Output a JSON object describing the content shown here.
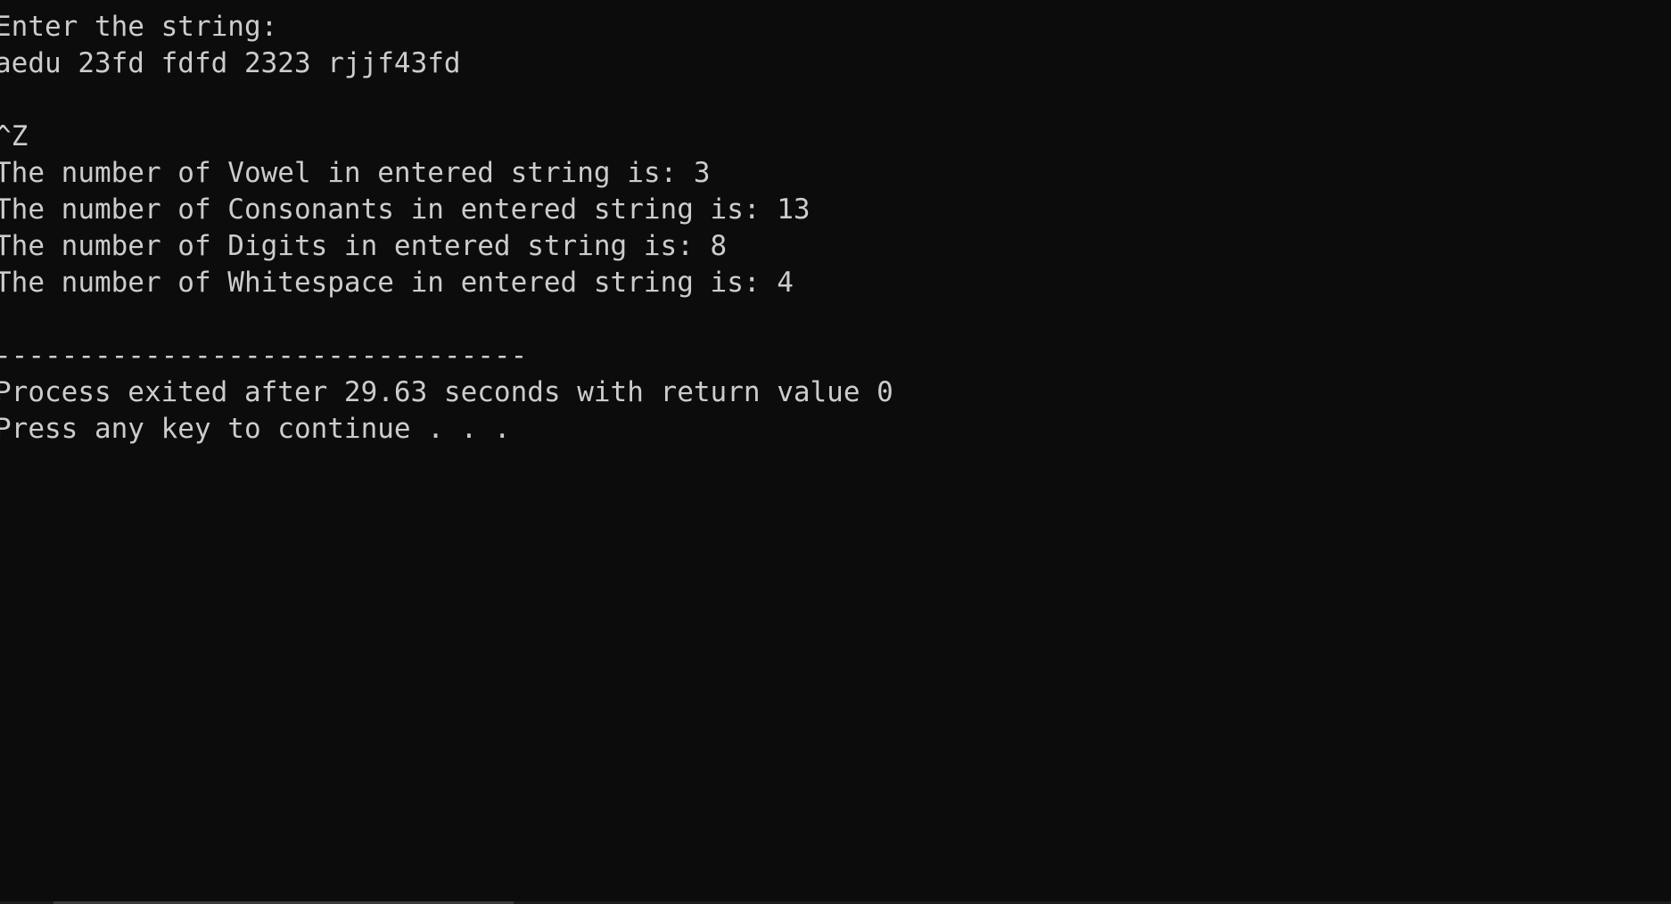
{
  "console": {
    "lines": [
      "Enter the string:",
      "aedu 23fd fdfd 2323 rjjf43fd",
      "",
      "^Z",
      "The number of Vowel in entered string is: 3",
      "The number of Consonants in entered string is: 13",
      "The number of Digits in entered string is: 8",
      "The number of Whitespace in entered string is: 4",
      "",
      "--------------------------------",
      "Process exited after 29.63 seconds with return value 0",
      "Press any key to continue . . ."
    ]
  },
  "colors": {
    "background": "#0c0c0c",
    "text": "#cccccc"
  }
}
